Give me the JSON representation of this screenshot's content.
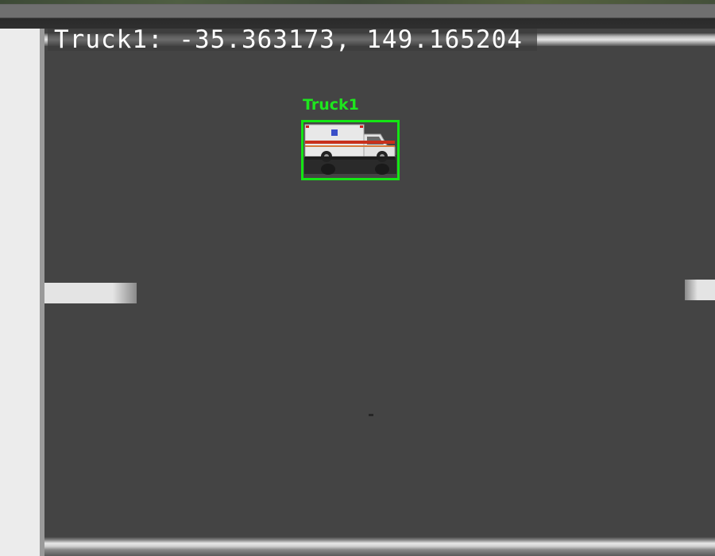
{
  "overlay": {
    "coordinate_readout": "Truck1: -35.363173, 149.165204"
  },
  "detection": {
    "label": "Truck1",
    "box_color": "#14e614",
    "label_color": "#1ee61e"
  },
  "vehicle": {
    "type_icon": "ambulance-icon"
  },
  "colors": {
    "ground": "#444444",
    "road_marking": "#e4e4e4",
    "left_margin": "#ececec"
  }
}
